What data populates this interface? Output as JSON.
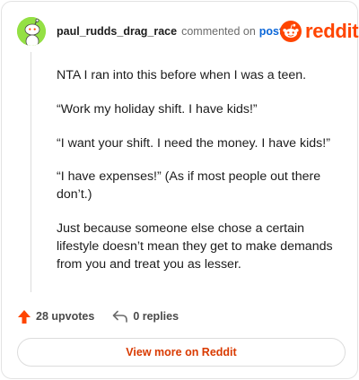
{
  "comment": {
    "username": "paul_rudds_drag_race",
    "action_text": "commented on",
    "post_link": "post",
    "paragraphs": [
      "NTA I ran into this before when I was a teen.",
      "“Work my holiday shift. I have kids!”",
      "“I want your shift. I need the money. I have kids!”",
      "“I have expenses!” (As if most people out there don’t.)",
      "Just because someone else chose a certain lifestyle doesn’t mean they get to make demands from you and treat you as lesser."
    ]
  },
  "brand": {
    "name": "reddit",
    "color": "#ff4500"
  },
  "avatar": {
    "icon": "snoo-avatar-icon",
    "background": "#94e044"
  },
  "actions": {
    "upvotes": "28 upvotes",
    "replies": "0 replies"
  },
  "footer": {
    "view_more": "View more on Reddit"
  }
}
